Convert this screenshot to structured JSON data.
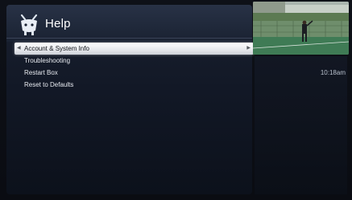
{
  "header": {
    "title": "Help",
    "logo_icon": "tivo-logo-icon"
  },
  "menu": {
    "items": [
      {
        "label": "Account & System Info",
        "selected": true
      },
      {
        "label": "Troubleshooting",
        "selected": false
      },
      {
        "label": "Restart Box",
        "selected": false
      },
      {
        "label": "Reset to Defaults",
        "selected": false
      }
    ]
  },
  "status": {
    "time": "10:18am"
  },
  "colors": {
    "accent": "#6a8fd8",
    "selection": "#f0f1f3",
    "background": "#0e1118"
  }
}
